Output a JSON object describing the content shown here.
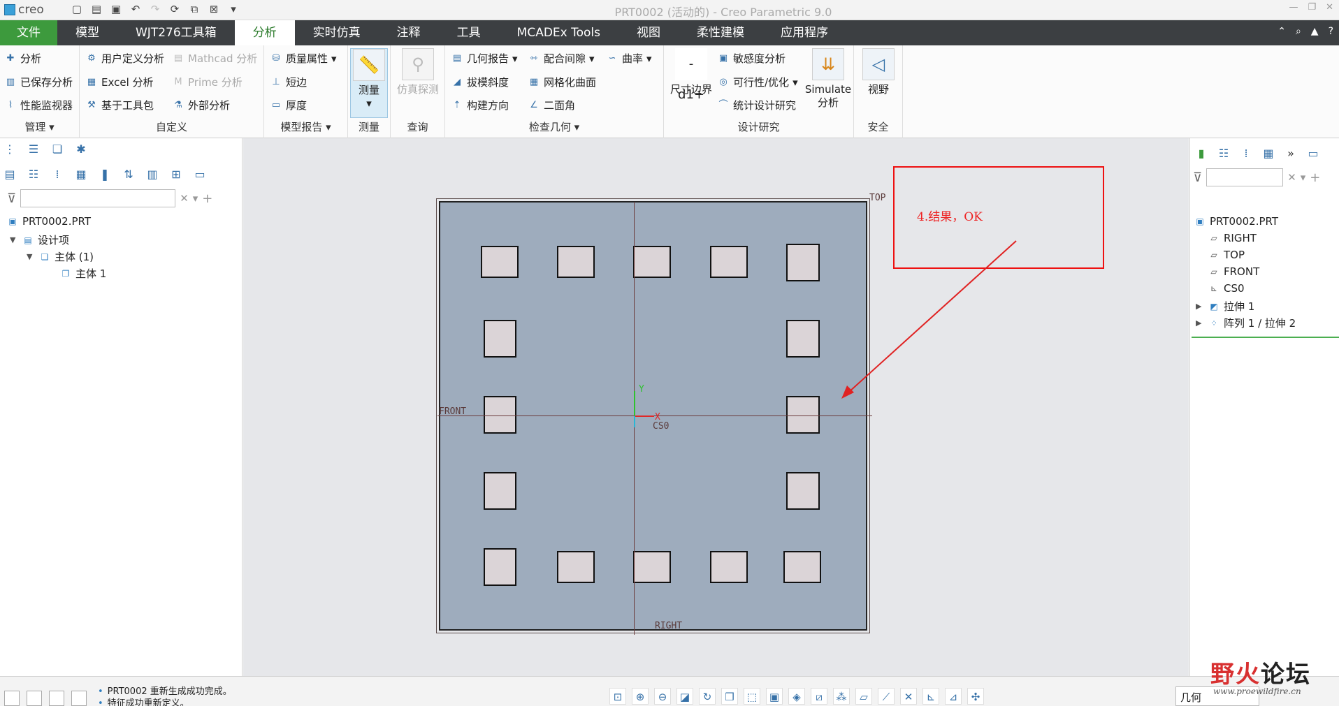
{
  "app": {
    "logo": "creo",
    "window_title": "PRT0002 (活动的) - Creo Parametric 9.0"
  },
  "tabs": [
    {
      "label": "文件"
    },
    {
      "label": "模型"
    },
    {
      "label": "WJT276工具箱"
    },
    {
      "label": "分析"
    },
    {
      "label": "实时仿真"
    },
    {
      "label": "注释"
    },
    {
      "label": "工具"
    },
    {
      "label": "MCADEx Tools"
    },
    {
      "label": "视图"
    },
    {
      "label": "柔性建模"
    },
    {
      "label": "应用程序"
    }
  ],
  "ribbon": {
    "manage": {
      "items": [
        "分析",
        "已保存分析",
        "性能监视器"
      ],
      "label": "管理"
    },
    "custom": {
      "items": [
        "用户定义分析",
        "Excel 分析",
        "基于工具包",
        "Mathcad 分析",
        "Prime 分析",
        "外部分析"
      ],
      "label": "自定义"
    },
    "model_report": {
      "items": [
        "质量属性",
        "短边",
        "厚度"
      ],
      "label": "模型报告"
    },
    "measure": {
      "button": "测量",
      "label": "测量"
    },
    "query": {
      "button": "仿真探测",
      "label": "查询"
    },
    "inspect": {
      "items": [
        "几何报告",
        "拔模斜度",
        "构建方向",
        "配合间隙",
        "网格化曲面",
        "二面角",
        "曲率"
      ],
      "label": "检查几何"
    },
    "design_study": {
      "items": [
        "敏感度分析",
        "可行性/优化",
        "统计设计研究"
      ],
      "big1": "尺寸边界",
      "big2a": "Simulate",
      "big2b": "分析",
      "label": "设计研究"
    },
    "safety": {
      "button": "视野",
      "label": "安全"
    }
  },
  "left_tree": [
    {
      "label": "PRT0002.PRT"
    },
    {
      "label": "设计项"
    },
    {
      "label": "主体 (1)"
    },
    {
      "label": "主体 1"
    }
  ],
  "right_tree": [
    {
      "label": "PRT0002.PRT"
    },
    {
      "label": "RIGHT"
    },
    {
      "label": "TOP"
    },
    {
      "label": "FRONT"
    },
    {
      "label": "CS0"
    },
    {
      "label": "拉伸 1"
    },
    {
      "label": "阵列 1 / 拉伸 2"
    }
  ],
  "graphics": {
    "plane_top": "TOP",
    "plane_front": "FRONT",
    "plane_right": "RIGHT",
    "csys": "CS0",
    "axis_x": "X",
    "axis_y": "Y"
  },
  "annotation": {
    "text": "4.结果，OK",
    "color": "#e22222"
  },
  "status": {
    "messages": [
      "PRT0002 重新生成成功完成。",
      "特征成功重新定义。"
    ],
    "selection_filter": "几何"
  },
  "watermark": {
    "name_red": "野火",
    "name_black": "论坛",
    "url": "www.proewildfire.cn"
  }
}
